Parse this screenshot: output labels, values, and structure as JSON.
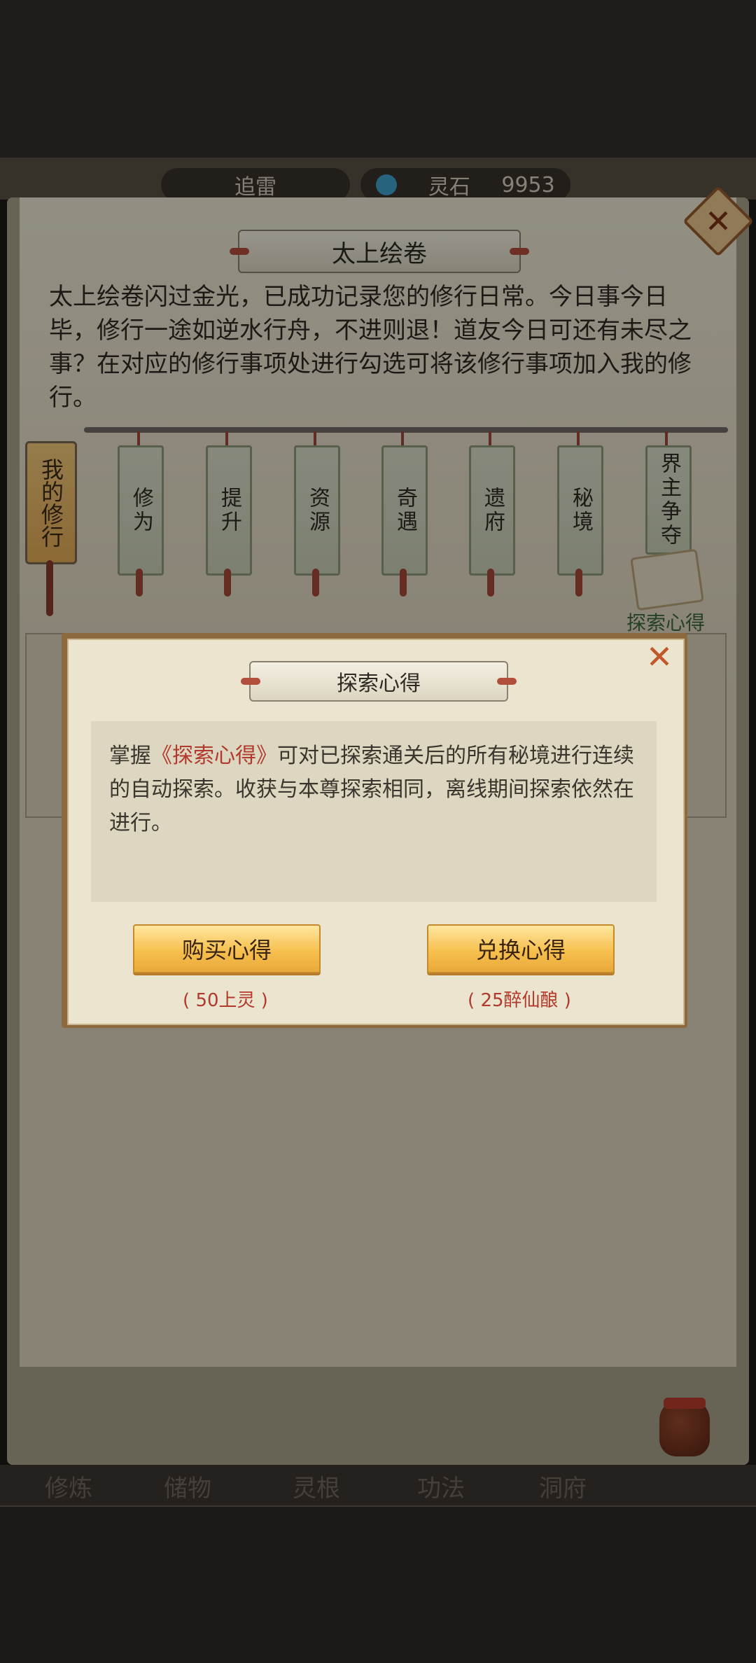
{
  "status": {
    "name": "追雷",
    "currency_label": "灵石",
    "currency_value": "9953"
  },
  "scroll": {
    "title": "太上绘卷",
    "intro": "太上绘卷闪过金光，已成功记录您的修行日常。今日事今日毕，修行一途如逆水行舟，不进则退！道友今日可还有未尽之事？在对应的修行事项处进行勾选可将该修行事项加入我的修行。",
    "my_practice": "我的修行",
    "banners": [
      "修为",
      "提升",
      "资源",
      "奇遇",
      "遗府",
      "秘境",
      "界主争夺"
    ],
    "explore_label": "探索心得"
  },
  "modal": {
    "title": "探索心得",
    "text_prefix": "掌握",
    "text_highlight": "《探索心得》",
    "text_suffix": "可对已探索通关后的所有秘境进行连续的自动探索。收获与本尊探索相同，离线期间探索依然在进行。",
    "buy_label": "购买心得",
    "buy_cost": "( 50上灵 )",
    "exchange_label": "兑换心得",
    "exchange_cost": "( 25醉仙酿 )"
  },
  "bottom_nav": [
    "修炼",
    "储物",
    "灵根",
    "功法",
    "洞府"
  ],
  "colors": {
    "accent_gold": "#f6c04e",
    "highlight_red": "#b23a2c",
    "banner_green": "#c9cfb6"
  }
}
